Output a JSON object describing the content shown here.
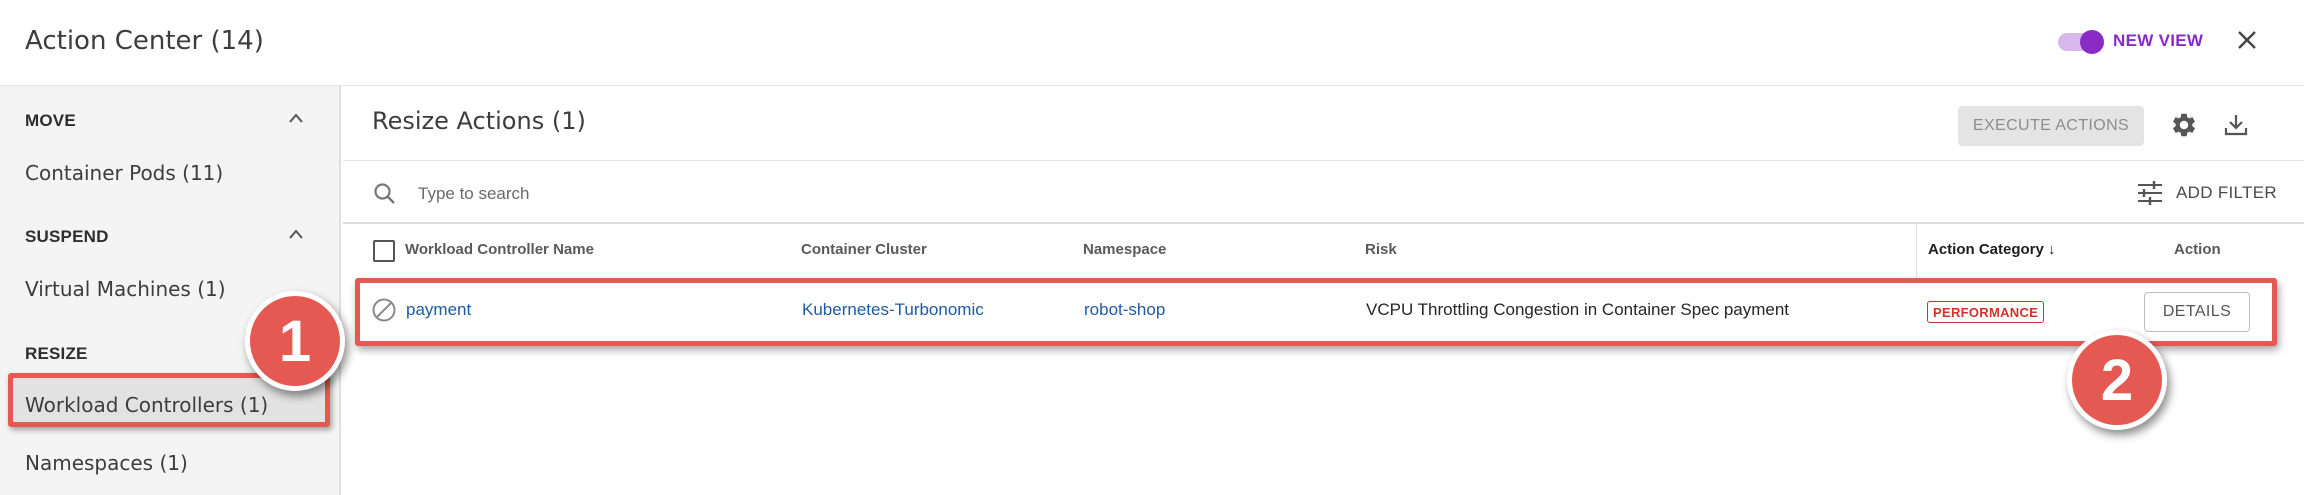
{
  "header": {
    "title": "Action Center (14)",
    "new_view_label": "NEW VIEW",
    "toggle_on": true
  },
  "sidebar": {
    "sections": [
      {
        "label": "MOVE",
        "items": [
          "Container Pods (11)"
        ]
      },
      {
        "label": "SUSPEND",
        "items": [
          "Virtual Machines (1)"
        ]
      },
      {
        "label": "RESIZE",
        "items": [
          "Workload Controllers (1)",
          "Namespaces (1)"
        ]
      }
    ],
    "selected_item": "Workload Controllers (1)"
  },
  "main": {
    "title": "Resize Actions (1)",
    "execute_label": "EXECUTE ACTIONS",
    "search_placeholder": "Type to search",
    "add_filter_label": "ADD FILTER",
    "columns": [
      "Workload Controller Name",
      "Container Cluster",
      "Namespace",
      "Risk",
      "Action Category ↓",
      "Action"
    ],
    "rows": [
      {
        "name": "payment",
        "cluster": "Kubernetes-Turbonomic",
        "namespace": "robot-shop",
        "risk": "VCPU Throttling Congestion in Container Spec payment",
        "category": "PERFORMANCE",
        "action": "DETAILS"
      }
    ]
  },
  "callouts": [
    "1",
    "2"
  ],
  "colors": {
    "accent": "#8a2bc6",
    "callout": "#e45a52",
    "link": "#1f5aa6",
    "badge": "#d0332b"
  }
}
